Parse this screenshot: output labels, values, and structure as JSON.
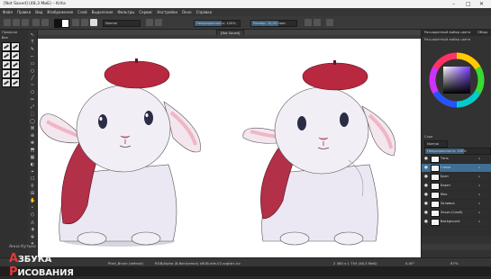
{
  "window": {
    "title": "[Not Saved] (48,3 MиБ) – Krita",
    "controls": [
      "–",
      "□",
      "✕"
    ]
  },
  "menu": {
    "items": [
      "Файл",
      "Правка",
      "Вид",
      "Изображение",
      "Слой",
      "Выделение",
      "Фильтры",
      "Сервис",
      "Настройки",
      "Окно",
      "Справка"
    ]
  },
  "toolbar": {
    "blend_mode": "Normal",
    "opacity_label": "Непрозрачность: 100%",
    "size_label": "Размер: 10,00 пикс",
    "fg_color": "#111111",
    "bg_color": "#ffffff",
    "accent_color": "#3d5f7c"
  },
  "left_panel": {
    "presets_title": "Профили",
    "tag_label": "Все",
    "tools": [
      "↖",
      "T",
      "✎",
      "⌐",
      "▭",
      "○",
      "╱",
      "~",
      "⬠",
      "✂",
      "⤢",
      "⬚",
      "◯",
      "⌘",
      "⊕",
      "✥",
      "⬒",
      "▦",
      "◐",
      "⌖",
      "☐",
      "⚲",
      "⊞",
      "✋",
      "⚬",
      "⬡",
      "◬",
      "⬗",
      "⬙",
      "✦"
    ]
  },
  "canvas": {
    "tab_label": "[Not Saved]",
    "background": "#ffffff"
  },
  "status_bar": {
    "brush_preset": "Pixel_Brush (default)",
    "color_info": "RGB/Alpha (8-бит/канал)  sRGB-elle-V2-srgbtrc.icc",
    "dimensions": "2 480 x 1 754 (48,3 MиБ)",
    "rotation": "0,00°",
    "zoom": "67%"
  },
  "right_panel": {
    "tab_advanced_color": "Расширенный выбор цвета",
    "tab_overview": "Обзор",
    "color_section_title": "Расширенный выбор цвета",
    "layers_title": "Слои",
    "layer_blend": "Normal",
    "layer_opacity": "Непрозрачность: 100%",
    "layers": [
      {
        "name": "Тень",
        "visible": "●",
        "active": false
      },
      {
        "name": "Глаза",
        "visible": "●",
        "active": true
      },
      {
        "name": "Бант",
        "visible": "●",
        "active": false
      },
      {
        "name": "Берет",
        "visible": "●",
        "active": false
      },
      {
        "name": "Мех",
        "visible": "●",
        "active": false
      },
      {
        "name": "Заливка",
        "visible": "●",
        "active": false
      },
      {
        "name": "Эскиз (Слой)",
        "visible": "●",
        "active": false
      },
      {
        "name": "Background",
        "visible": "●",
        "active": false
      }
    ]
  },
  "watermark": {
    "sub": "Анна Кутько",
    "brand_a": "А",
    "brand_rest": "ЗБУКА",
    "brand_r": "Р",
    "brand_rest2": "ИСОВАНИЯ"
  }
}
